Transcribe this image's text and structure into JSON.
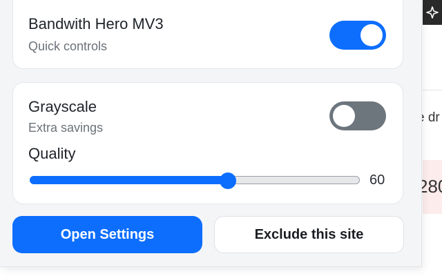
{
  "background_page": {
    "text_fragment": "e dr",
    "number_fragment": "280",
    "topbar_icon": "sparkle-icon"
  },
  "extension": {
    "name": "Bandwith Hero MV3",
    "subtitle": "Quick controls",
    "enabled": true
  },
  "grayscale": {
    "label": "Grayscale",
    "subtitle": "Extra savings",
    "enabled": false
  },
  "quality": {
    "label": "Quality",
    "value": "60",
    "min": 0,
    "max": 100
  },
  "buttons": {
    "open_settings": "Open Settings",
    "exclude_site": "Exclude this site"
  },
  "colors": {
    "accent": "#0d6efd",
    "toggle_off": "#6d757d",
    "panel_bg": "#f4f5f7"
  }
}
